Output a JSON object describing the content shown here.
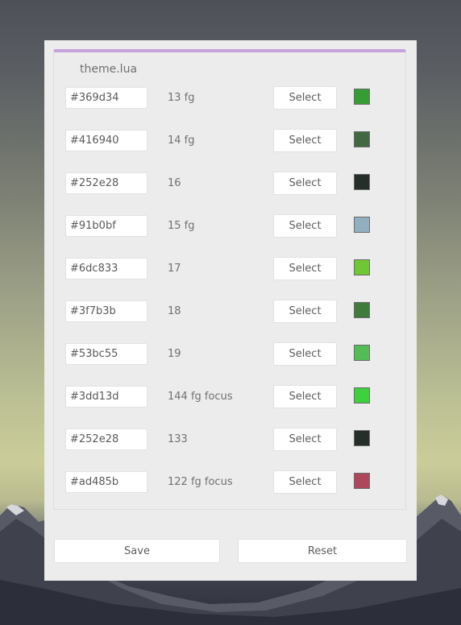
{
  "colors": {
    "accent": "#c5a3dc",
    "dialog_bg": "#ececec"
  },
  "panel": {
    "title": "theme.lua"
  },
  "rows": [
    {
      "hex": "#369d34",
      "label": "13 fg",
      "select_label": "Select",
      "swatch": "#369d34"
    },
    {
      "hex": "#416940",
      "label": "14 fg",
      "select_label": "Select",
      "swatch": "#416940"
    },
    {
      "hex": "#252e28",
      "label": "16",
      "select_label": "Select",
      "swatch": "#252e28"
    },
    {
      "hex": "#91b0bf",
      "label": "15 fg",
      "select_label": "Select",
      "swatch": "#91b0bf"
    },
    {
      "hex": "#6dc833",
      "label": "17",
      "select_label": "Select",
      "swatch": "#6dc833"
    },
    {
      "hex": "#3f7b3b",
      "label": "18",
      "select_label": "Select",
      "swatch": "#3f7b3b"
    },
    {
      "hex": "#53bc55",
      "label": "19",
      "select_label": "Select",
      "swatch": "#53bc55"
    },
    {
      "hex": "#3dd13d",
      "label": "144 fg focus",
      "select_label": "Select",
      "swatch": "#3dd13d"
    },
    {
      "hex": "#252e28",
      "label": "133",
      "select_label": "Select",
      "swatch": "#252e28"
    },
    {
      "hex": "#ad485b",
      "label": "122 fg focus",
      "select_label": "Select",
      "swatch": "#ad485b"
    }
  ],
  "footer": {
    "save_label": "Save",
    "reset_label": "Reset"
  }
}
